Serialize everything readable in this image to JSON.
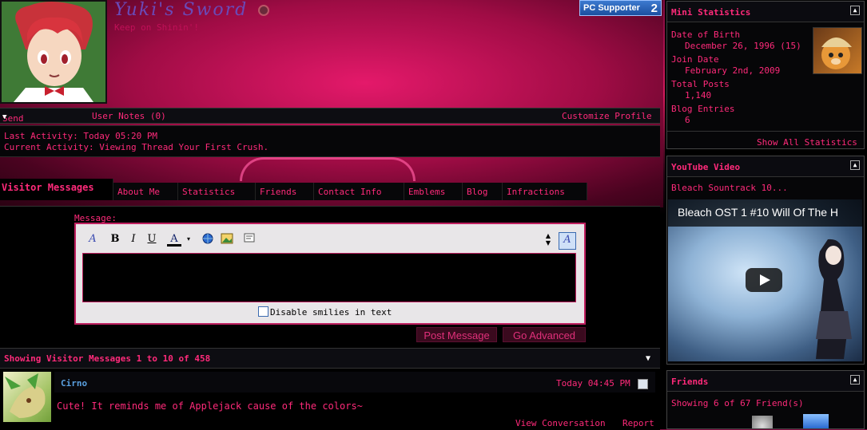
{
  "profile": {
    "username": "Yuki's Sword",
    "tagline": "Keep on Shinin'!",
    "badge_label": "PC Supporter",
    "badge_count": "2"
  },
  "actions": {
    "send_message": "Send Message",
    "user_notes": "User Notes (0)",
    "customize": "Customize Profile"
  },
  "activity": {
    "last_label": "Last Activity:",
    "last_value": "Today 05:20 PM",
    "current_label": "Current Activity:",
    "current_value": "Viewing Thread Your First Crush."
  },
  "tabs": [
    "Visitor Messages",
    "About Me",
    "Statistics",
    "Friends",
    "Contact Info",
    "Emblems",
    "Blog",
    "Infractions"
  ],
  "editor": {
    "label": "Message:",
    "smilies_label": "Disable smilies in text",
    "post_button": "Post Message",
    "advanced_button": "Go Advanced"
  },
  "messages": {
    "showing": "Showing Visitor Messages 1 to 10 of 458",
    "items": [
      {
        "author": "Cirno",
        "time": "Today 04:45 PM",
        "text": "Cute! It reminds me of Applejack cause of the colors~",
        "view_link": "View Conversation",
        "report_link": "Report"
      }
    ]
  },
  "mini_stats": {
    "title": "Mini Statistics",
    "dob_label": "Date of Birth",
    "dob_value": "December 26, 1996 (15)",
    "join_label": "Join Date",
    "join_value": "February 2nd, 2009",
    "posts_label": "Total Posts",
    "posts_value": "1,140",
    "blog_label": "Blog Entries",
    "blog_value": "6",
    "show_all": "Show All Statistics"
  },
  "youtube": {
    "title": "YouTube Video",
    "caption": "Bleach Sountrack 10...",
    "video_title": "Bleach OST 1 #10 Will Of The H"
  },
  "friends": {
    "title": "Friends",
    "showing": "Showing 6 of 67 Friend(s)"
  }
}
